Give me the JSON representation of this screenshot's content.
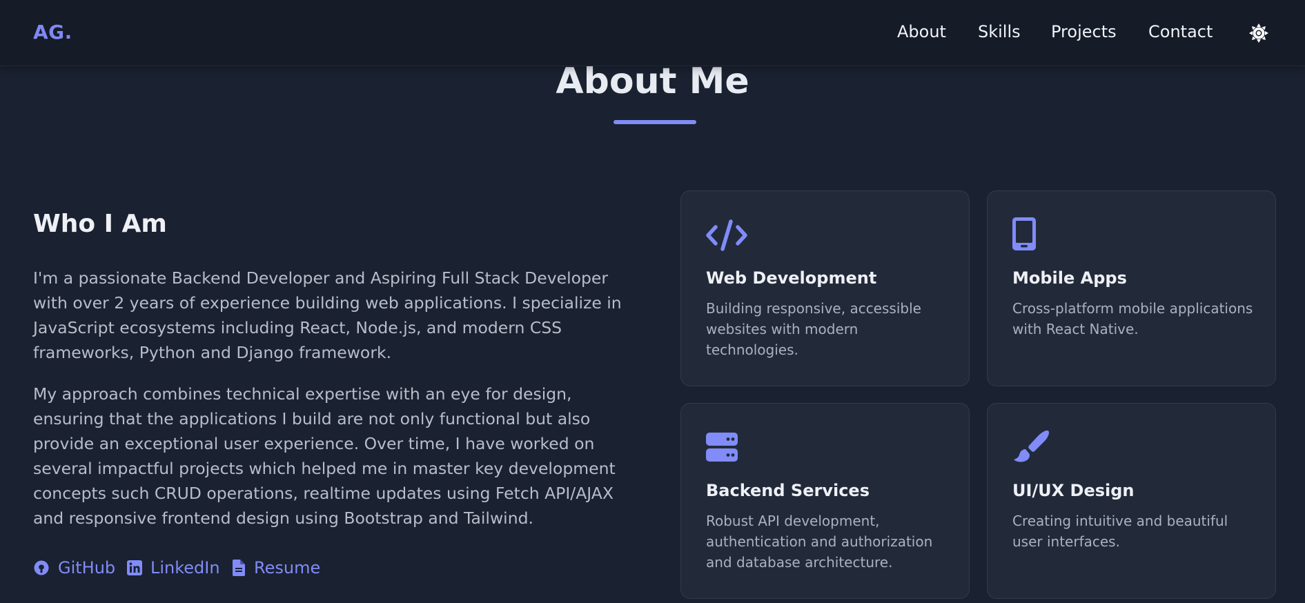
{
  "header": {
    "logo": "AG.",
    "nav": [
      "About",
      "Skills",
      "Projects",
      "Contact"
    ],
    "theme_toggle_icon": "sun-icon"
  },
  "about": {
    "title": "About Me",
    "who_title": "Who I Am",
    "paragraphs": [
      "I'm a passionate Backend Developer and Aspiring Full Stack Developer with over 2 years of experience building web applications. I specialize in JavaScript ecosystems including React, Node.js, and modern CSS frameworks, Python and Django framework.",
      "My approach combines technical expertise with an eye for design, ensuring that the applications I build are not only functional but also provide an exceptional user experience. Over time, I have worked on several impactful projects which helped me in master key development concepts such CRUD operations, realtime updates using Fetch API/AJAX and responsive frontend design using Bootstrap and Tailwind."
    ],
    "links": [
      {
        "label": "GitHub",
        "icon": "github-icon"
      },
      {
        "label": "LinkedIn",
        "icon": "linkedin-icon"
      },
      {
        "label": "Resume",
        "icon": "file-icon"
      }
    ]
  },
  "services": [
    {
      "title": "Web Development",
      "description": "Building responsive, accessible websites with modern technologies.",
      "icon": "code-icon"
    },
    {
      "title": "Mobile Apps",
      "description": "Cross-platform mobile applications with React Native.",
      "icon": "mobile-icon"
    },
    {
      "title": "Backend Services",
      "description": "Robust API development, authentication and authorization and database architecture.",
      "icon": "server-icon"
    },
    {
      "title": "UI/UX Design",
      "description": "Creating intuitive and beautiful user interfaces.",
      "icon": "paintbrush-icon"
    }
  ],
  "colors": {
    "accent": "#818cf8",
    "background": "#1a2130",
    "navbar": "#151b27",
    "card": "#222a3a"
  }
}
